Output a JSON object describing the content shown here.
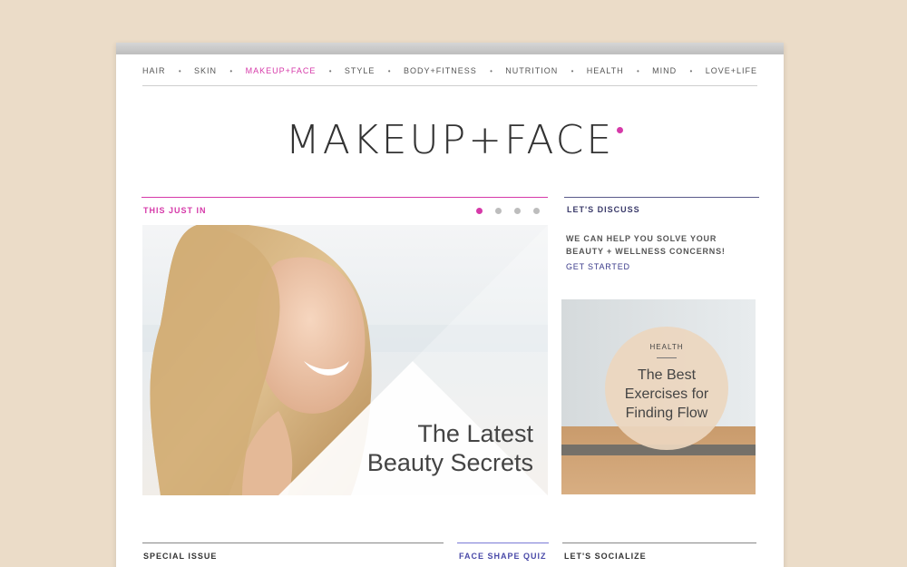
{
  "nav": {
    "items": [
      {
        "label": "HAIR"
      },
      {
        "label": "SKIN"
      },
      {
        "label": "MAKEUP+FACE",
        "active": true
      },
      {
        "label": "STYLE"
      },
      {
        "label": "BODY+FITNESS"
      },
      {
        "label": "NUTRITION"
      },
      {
        "label": "HEALTH"
      },
      {
        "label": "MIND"
      },
      {
        "label": "LOVE+LIFE"
      }
    ],
    "separator": "•"
  },
  "page_title": "MAKEUP+FACE",
  "this_just_in": {
    "label": "THIS JUST IN",
    "headline_line1": "The Latest",
    "headline_line2": "Beauty Secrets",
    "slide_count": 4,
    "active_slide": 1
  },
  "lets_discuss": {
    "label": "LET'S DISCUSS",
    "body_line1": "WE CAN HELP YOU SOLVE YOUR",
    "body_line2": "BEAUTY + WELLNESS CONCERNS!",
    "cta": "GET STARTED"
  },
  "feature_card": {
    "category": "HEALTH",
    "title_line1": "The Best",
    "title_line2": "Exercises for",
    "title_line3": "Finding Flow"
  },
  "bottom": {
    "special_issue": "SPECIAL ISSUE",
    "face_shape_quiz": "FACE SHAPE QUIZ",
    "lets_socialize": "LET'S SOCIALIZE"
  },
  "colors": {
    "accent": "#d63aa9",
    "link": "#3a3a8a",
    "background": "#ebdcc8",
    "circle": "#ecd6be"
  }
}
